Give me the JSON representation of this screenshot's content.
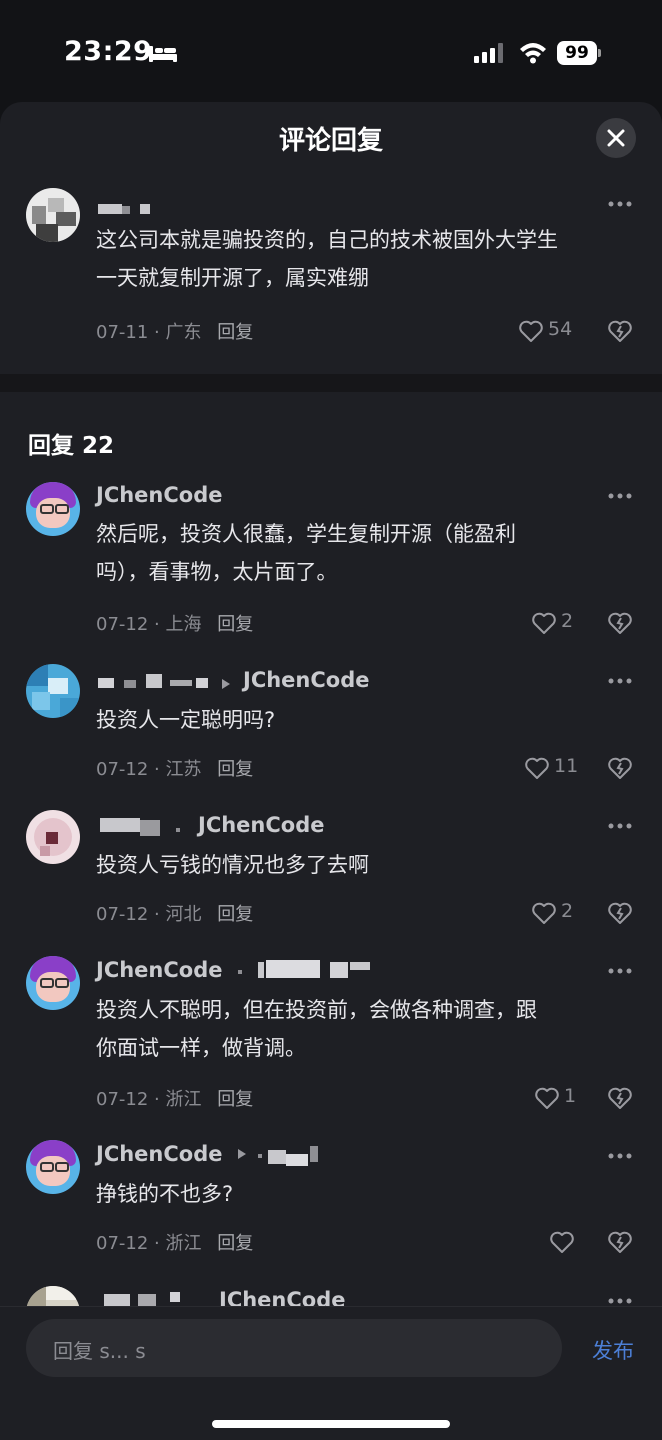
{
  "status_bar": {
    "time": "23:29",
    "battery": "99"
  },
  "sheet": {
    "title": "评论回复"
  },
  "main_comment": {
    "text_line1": "这公司本就是骗投资的，自己的技术被国外大学生",
    "text_line2": "一天就复制开源了，属实难绷",
    "date": "07-11",
    "location": "广东",
    "reply_label": "回复",
    "likes": "54"
  },
  "replies": {
    "header": "回复 22",
    "items": [
      {
        "name": "JChenCode",
        "target": "",
        "text_line1": "然后呢，投资人很蠢，学生复制开源（能盈利",
        "text_line2": "吗），看事物，太片面了。",
        "date": "07-12",
        "location": "上海",
        "reply_label": "回复",
        "likes": "2"
      },
      {
        "name": "",
        "target": "JChenCode",
        "text_line1": "投资人一定聪明吗?",
        "text_line2": "",
        "date": "07-12",
        "location": "江苏",
        "reply_label": "回复",
        "likes": "11"
      },
      {
        "name": "",
        "target": "JChenCode",
        "text_line1": "投资人亏钱的情况也多了去啊",
        "text_line2": "",
        "date": "07-12",
        "location": "河北",
        "reply_label": "回复",
        "likes": "2"
      },
      {
        "name": "JChenCode",
        "target": "",
        "text_line1": "投资人不聪明，但在投资前，会做各种调查，跟",
        "text_line2": "你面试一样，做背调。",
        "date": "07-12",
        "location": "浙江",
        "reply_label": "回复",
        "likes": "1"
      },
      {
        "name": "JChenCode",
        "target": "",
        "text_line1": "挣钱的不也多?",
        "text_line2": "",
        "date": "07-12",
        "location": "浙江",
        "reply_label": "回复",
        "likes": ""
      },
      {
        "name": "",
        "target": "JChenCode"
      }
    ]
  },
  "input": {
    "placeholder": "回复 s... s",
    "publish": "发布"
  },
  "icons": {
    "close": "close-icon",
    "more": "more-icon",
    "like": "heart-icon",
    "dislike": "dislike-icon",
    "reply_arrow": "triangle-right-icon"
  },
  "colors": {
    "background": "#121316",
    "sheet": "#1e1f24",
    "accent": "#4c7fd6"
  }
}
